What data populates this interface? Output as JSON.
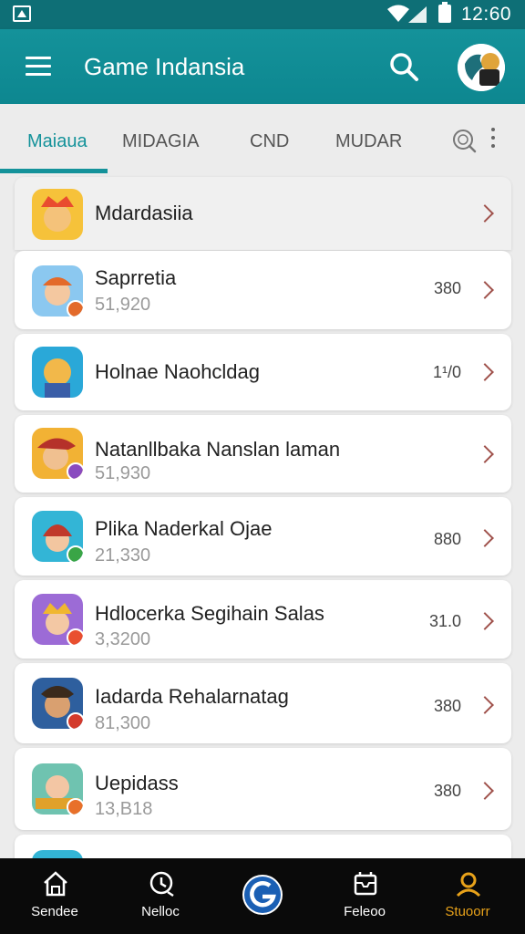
{
  "status_bar": {
    "time": "12:60"
  },
  "app_bar": {
    "title": "Game Indansia"
  },
  "tabs": [
    {
      "label": "Maiaua",
      "active": true
    },
    {
      "label": "MIDAGIA",
      "active": false
    },
    {
      "label": "CND",
      "active": false
    },
    {
      "label": "MUDAR",
      "active": false
    }
  ],
  "list": [
    {
      "name": "Mdardasiia",
      "sub": "",
      "value": "",
      "colors": [
        "#f6c23a",
        "#e94c2f"
      ]
    },
    {
      "name": "Saprretia",
      "sub": "51,920",
      "value": "380",
      "colors": [
        "#8bc8f0",
        "#e36a2a"
      ]
    },
    {
      "name": "Holnae Naohcldag",
      "sub": "",
      "value": "1¹/0",
      "colors": [
        "#2aa8d8",
        "#3a5ea8"
      ]
    },
    {
      "name": "Natanllbaka Nanslan laman",
      "sub": "51,930",
      "value": "",
      "colors": [
        "#f2b234",
        "#8a4bbf"
      ]
    },
    {
      "name": "Plika Naderkal Ojae",
      "sub": "21,330",
      "value": "880",
      "colors": [
        "#33b5d6",
        "#3aa546"
      ]
    },
    {
      "name": "Hdlocerka Segihain Salas",
      "sub": "3,3200",
      "value": "31.0",
      "colors": [
        "#9c6bd6",
        "#e94f2f"
      ]
    },
    {
      "name": "Iadarda Rehalarnatag",
      "sub": "81,300",
      "value": "380",
      "colors": [
        "#2e5f9e",
        "#d33a2c"
      ]
    },
    {
      "name": "Uepidass",
      "sub": "13,B18",
      "value": "380",
      "colors": [
        "#6fc3b0",
        "#e8702a"
      ]
    }
  ],
  "bottom_nav": [
    {
      "label": "Sendee",
      "icon": "home-icon",
      "active": false
    },
    {
      "label": "Nelloc",
      "icon": "chat-icon",
      "active": false
    },
    {
      "label": "Feleoo",
      "icon": "inbox-icon",
      "active": false
    },
    {
      "label": "Stuoorr",
      "icon": "profile-icon",
      "active": true
    }
  ],
  "colors": {
    "primary": "#14929a",
    "accent": "#e8a21a",
    "chevron": "#a0524c"
  }
}
